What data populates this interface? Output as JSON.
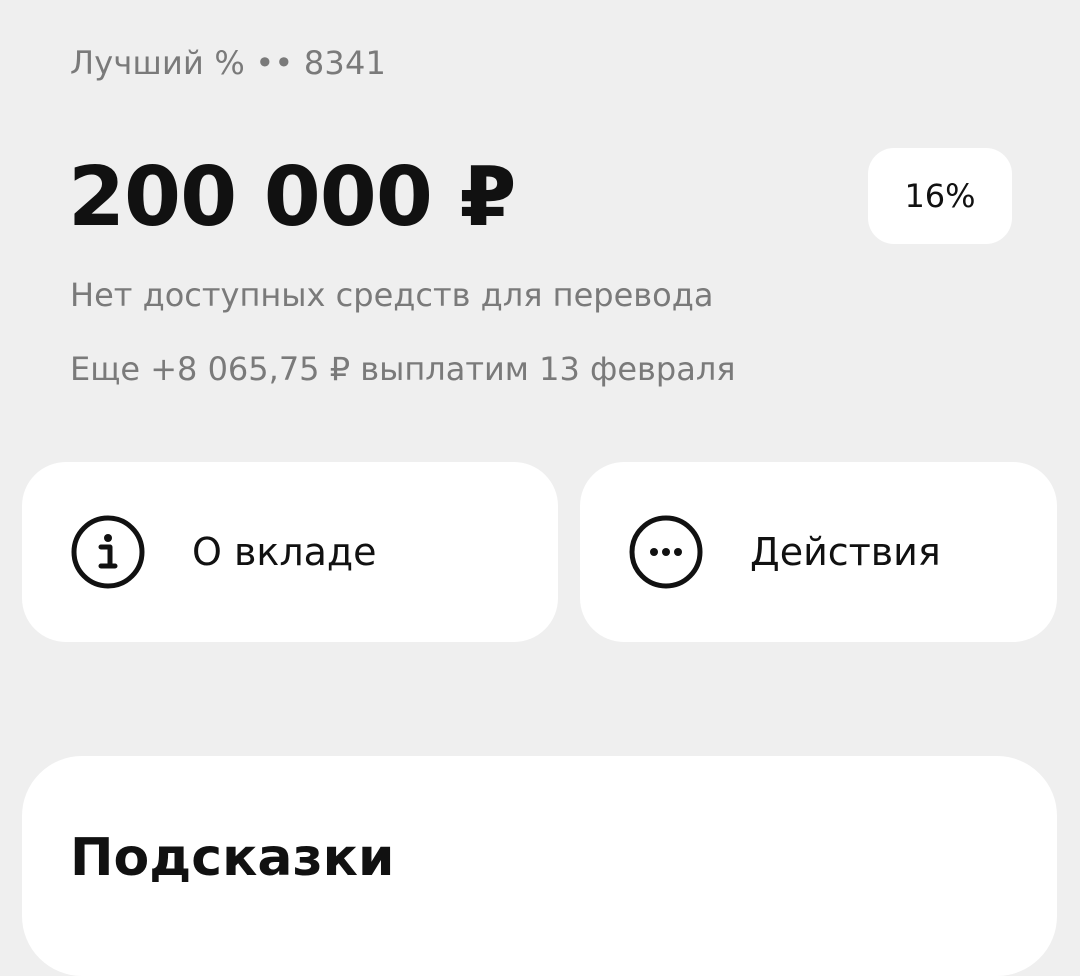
{
  "account": {
    "name": "Лучший % •• 8341"
  },
  "balance": {
    "amount": "200 000 ₽",
    "rate": "16%"
  },
  "notes": {
    "transfer": "Нет доступных средств для перевода",
    "payout": "Еще +8 065,75 ₽ выплатим 13 февраля"
  },
  "actions": {
    "about": {
      "label": "О вкладе",
      "icon": "info-icon"
    },
    "more": {
      "label": "Действия",
      "icon": "more-icon"
    }
  },
  "hints": {
    "title": "Подсказки"
  },
  "colors": {
    "background": "#efefef",
    "card": "#ffffff",
    "text_primary": "#111111",
    "text_secondary": "#7a7a7a"
  }
}
